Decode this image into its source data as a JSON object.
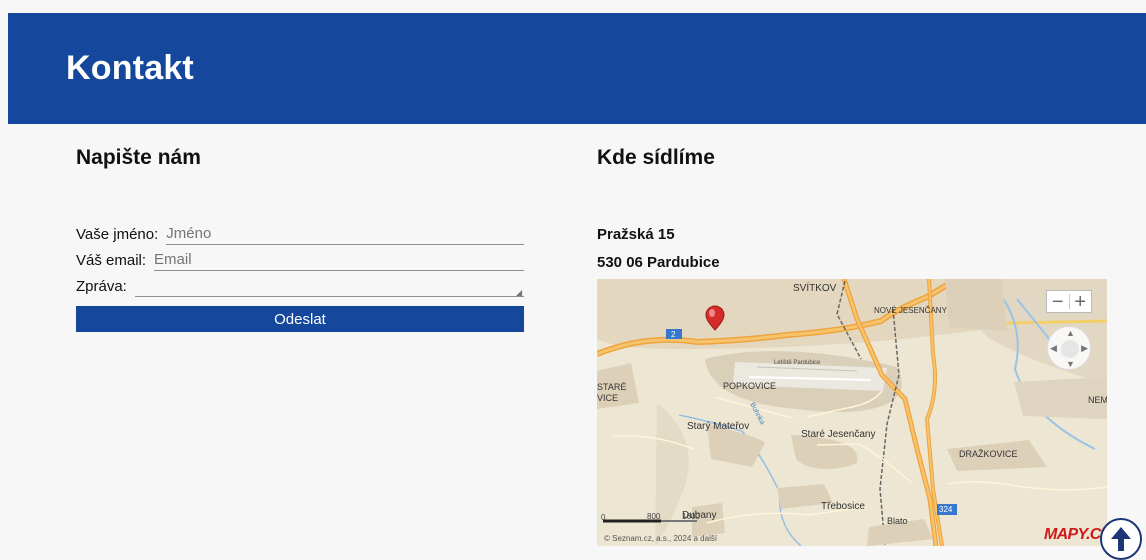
{
  "header": {
    "title": "Kontakt"
  },
  "contact_form": {
    "title": "Napište nám",
    "name_label": "Vaše jméno:",
    "name_placeholder": "Jméno",
    "email_label": "Váš email:",
    "email_placeholder": "Email",
    "message_label": "Zpráva:",
    "submit_label": "Odeslat"
  },
  "location": {
    "title": "Kde sídlíme",
    "street": "Pražská 15",
    "city": "530 06 Pardubice",
    "map": {
      "labels": {
        "svitkov": "SVÍTKOV",
        "nove_jesencany": "NOVÉ JESENČANY",
        "letiste": "Letiště Pardubice",
        "popkovice": "POPKOVICE",
        "stare_pre": "STARÉ",
        "stare_post": "VICE",
        "stary_materov": "Starý Mateřov",
        "stare_jesencany": "Staré Jesenčany",
        "drazkovice": "DRAŽKOVICE",
        "dubany": "Dubany",
        "trebosice": "Třebosice",
        "blato": "Blato",
        "nem": "NEM",
        "bohnka": "Bohnka",
        "route_2": "2",
        "route_324": "324",
        "scale_0": "0",
        "scale_800": "800",
        "scale_1600": "1600"
      },
      "copyright": "© Seznam.cz, a.s., 2024 a další",
      "logo": "MAPY.CZ",
      "zoom_in": "+",
      "zoom_out": "−"
    }
  },
  "colors": {
    "brand_blue": "#15479c",
    "map_marker_red": "#d52b2b"
  }
}
